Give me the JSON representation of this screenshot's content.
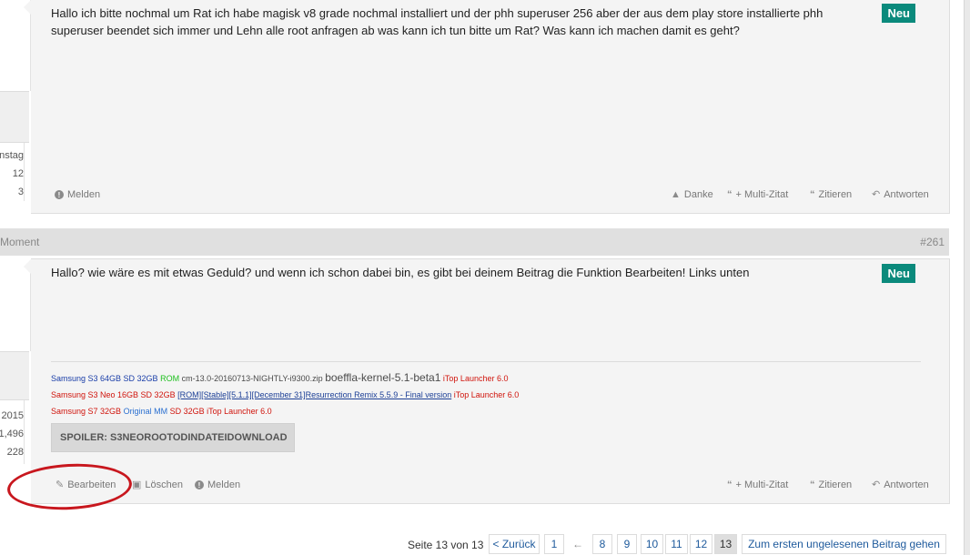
{
  "post1": {
    "body": "Hallo ich bitte nochmal um Rat ich habe magisk v8 grade nochmal installiert und der phh superuser 256 aber der aus dem play store installierte phh superuser beendet sich immer und Lehn alle root anfragen ab was kann ich tun bitte um Rat? Was kann ich machen damit es geht?",
    "badge": "Neu",
    "left_stats": [
      "nstag",
      "12",
      "3"
    ],
    "actions": {
      "melden": "Melden",
      "danke": "Danke",
      "multi_zitat": "+ Multi-Zitat",
      "zitieren": "Zitieren",
      "antworten": "Antworten"
    }
  },
  "post2": {
    "date": "Moment",
    "number": "#261",
    "body": "Hallo? wie wäre es mit etwas Geduld? und wenn ich schon dabei bin, es gibt bei deinem Beitrag die Funktion Bearbeiten! Links unten",
    "badge": "Neu",
    "left_stats": [
      "2015",
      "1,496",
      "228"
    ],
    "signature": {
      "line1": {
        "device": "Samsung S3 64GB SD 32GB",
        "rom": "ROM",
        "cm": "cm-13.0-20160713-NIGHTLY-i9300.zip",
        "kernel": "boeffla-kernel-5.1-beta1",
        "launcher": "iTop Launcher 6.0"
      },
      "line2": {
        "device": "Samsung S3 Neo 16GB SD 32GB",
        "rom_link": "[ROM][Stable][5.1.1][December 31]Resurrection Remix 5.5.9 - Final version",
        "launcher": "iTop Launcher 6.0"
      },
      "line3": {
        "device": "Samsung S7 32GB",
        "mm": "Original MM",
        "sd": "SD 32GB",
        "launcher": "iTop Launcher 6.0"
      }
    },
    "spoiler": "SPOILER: S3NEOROOTODINDATEIDOWNLOAD",
    "actions": {
      "bearbeiten": "Bearbeiten",
      "loeschen": "Löschen",
      "melden": "Melden",
      "multi_zitat": "+ Multi-Zitat",
      "zitieren": "Zitieren",
      "antworten": "Antworten"
    }
  },
  "pagination": {
    "label": "Seite 13 von 13",
    "prev": "< Zurück",
    "first": "1",
    "ellipsis": "←",
    "pages": [
      "8",
      "9",
      "10",
      "11",
      "12",
      "13"
    ],
    "current": "13",
    "unread": "Zum ersten ungelesenen Beitrag gehen"
  },
  "colors": {
    "badge": "#0b8a7c",
    "annotation_circle": "#c8171e"
  }
}
